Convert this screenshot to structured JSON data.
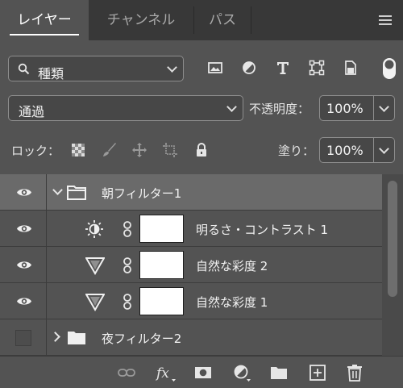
{
  "tabs": {
    "layers": "レイヤー",
    "channels": "チャンネル",
    "paths": "パス"
  },
  "filter": {
    "kind_label": "種類"
  },
  "blend": {
    "mode": "通過",
    "opacity_label": "不透明度：",
    "opacity_value": "100%"
  },
  "lock": {
    "label": "ロック：",
    "fill_label": "塗り：",
    "fill_value": "100%"
  },
  "layers": [
    {
      "name": "朝フィルター1",
      "type": "group",
      "expanded": true,
      "visible": true,
      "selected": true
    },
    {
      "name": "明るさ・コントラスト 1",
      "type": "brightness-contrast",
      "visible": true
    },
    {
      "name": "自然な彩度 2",
      "type": "vibrance",
      "visible": true
    },
    {
      "name": "自然な彩度 1",
      "type": "vibrance",
      "visible": true
    },
    {
      "name": "夜フィルター2",
      "type": "group",
      "expanded": false,
      "visible": false
    }
  ],
  "colors": {
    "panel_bg": "#535353",
    "tabbar_bg": "#383838",
    "selected_row": "#6a6a6a",
    "text": "#e6e6e6"
  }
}
